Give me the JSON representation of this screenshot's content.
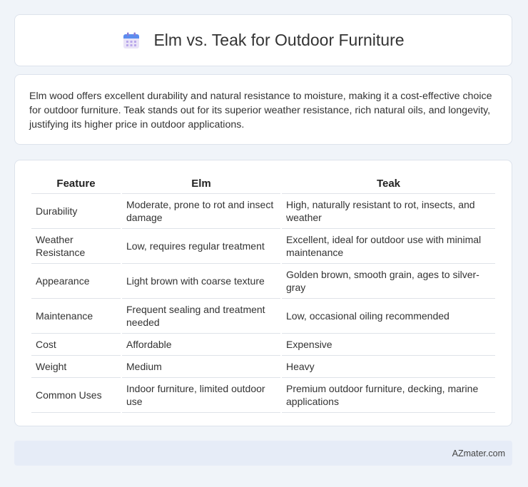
{
  "header": {
    "title": "Elm vs. Teak for Outdoor Furniture",
    "icon": "calendar-icon"
  },
  "intro": "Elm wood offers excellent durability and natural resistance to moisture, making it a cost-effective choice for outdoor furniture. Teak stands out for its superior weather resistance, rich natural oils, and longevity, justifying its higher price in outdoor applications.",
  "table": {
    "headers": [
      "Feature",
      "Elm",
      "Teak"
    ],
    "rows": [
      [
        "Durability",
        "Moderate, prone to rot and insect damage",
        "High, naturally resistant to rot, insects, and weather"
      ],
      [
        "Weather Resistance",
        "Low, requires regular treatment",
        "Excellent, ideal for outdoor use with minimal maintenance"
      ],
      [
        "Appearance",
        "Light brown with coarse texture",
        "Golden brown, smooth grain, ages to silver-gray"
      ],
      [
        "Maintenance",
        "Frequent sealing and treatment needed",
        "Low, occasional oiling recommended"
      ],
      [
        "Cost",
        "Affordable",
        "Expensive"
      ],
      [
        "Weight",
        "Medium",
        "Heavy"
      ],
      [
        "Common Uses",
        "Indoor furniture, limited outdoor use",
        "Premium outdoor furniture, decking, marine applications"
      ]
    ]
  },
  "footer": {
    "brand": "AZmater.com"
  }
}
